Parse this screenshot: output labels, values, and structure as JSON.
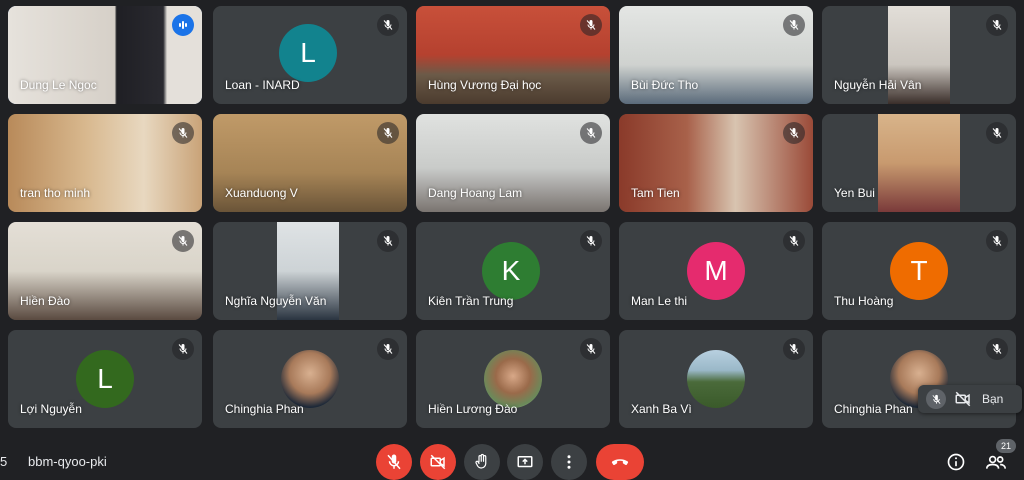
{
  "participants": [
    {
      "name": "Dung Le Ngoc",
      "speaking": true,
      "bg": "#e8e4de"
    },
    {
      "name": "Loan - INARD",
      "initial": "L",
      "avatar_color": "#12838e"
    },
    {
      "name": "Hùng Vương Đại học",
      "bg": "#b5412f"
    },
    {
      "name": "Bùi Đức Tho",
      "bg": "#d8dbd9"
    },
    {
      "name": "Nguyễn Hải Vân",
      "bg": "#dcd9d4"
    },
    {
      "name": "tran tho minh",
      "bg": "#c9a378"
    },
    {
      "name": "Xuanduong V",
      "bg": "#a68456"
    },
    {
      "name": "Dang Hoang Lam",
      "bg": "#c9cbc9"
    },
    {
      "name": "Tam Tien",
      "bg": "#a8614a"
    },
    {
      "name": "Yen Bui",
      "bg": "#c89a6f"
    },
    {
      "name": "Hiền Đào",
      "bg": "#d9d4c9"
    },
    {
      "name": "Nghĩa Nguyễn Văn",
      "bg": "#cdd3d6"
    },
    {
      "name": "Kiên Trần Trung",
      "initial": "K",
      "avatar_color": "#2e7d32"
    },
    {
      "name": "Man Le thi",
      "initial": "M",
      "avatar_color": "#e52b6e"
    },
    {
      "name": "Thu Hoàng",
      "initial": "T",
      "avatar_color": "#ef6c00"
    },
    {
      "name": "Lợi Nguyễn",
      "initial": "L",
      "avatar_color": "#33691e"
    },
    {
      "name": "Chinghia Phan"
    },
    {
      "name": "Hiền Lương Đào"
    },
    {
      "name": "Xanh Ba Vì"
    },
    {
      "name": "Chinghia Phan"
    }
  ],
  "self_view": {
    "label": "Bạn"
  },
  "bottom_bar": {
    "edge_number": "5",
    "meeting_code": "bbm-qyoo-pki",
    "participant_count": "21"
  },
  "icons": {
    "mic_off": "mic-off-icon",
    "cam_off": "videocam-off-icon",
    "hand": "hand-raise-icon",
    "present": "present-screen-icon",
    "more": "more-vert-icon",
    "hangup": "call-end-icon",
    "info": "info-icon",
    "people": "people-icon"
  },
  "colors": {
    "background": "#202124",
    "tile": "#3c4043",
    "danger": "#ea4335",
    "accent": "#8ab4f8"
  }
}
